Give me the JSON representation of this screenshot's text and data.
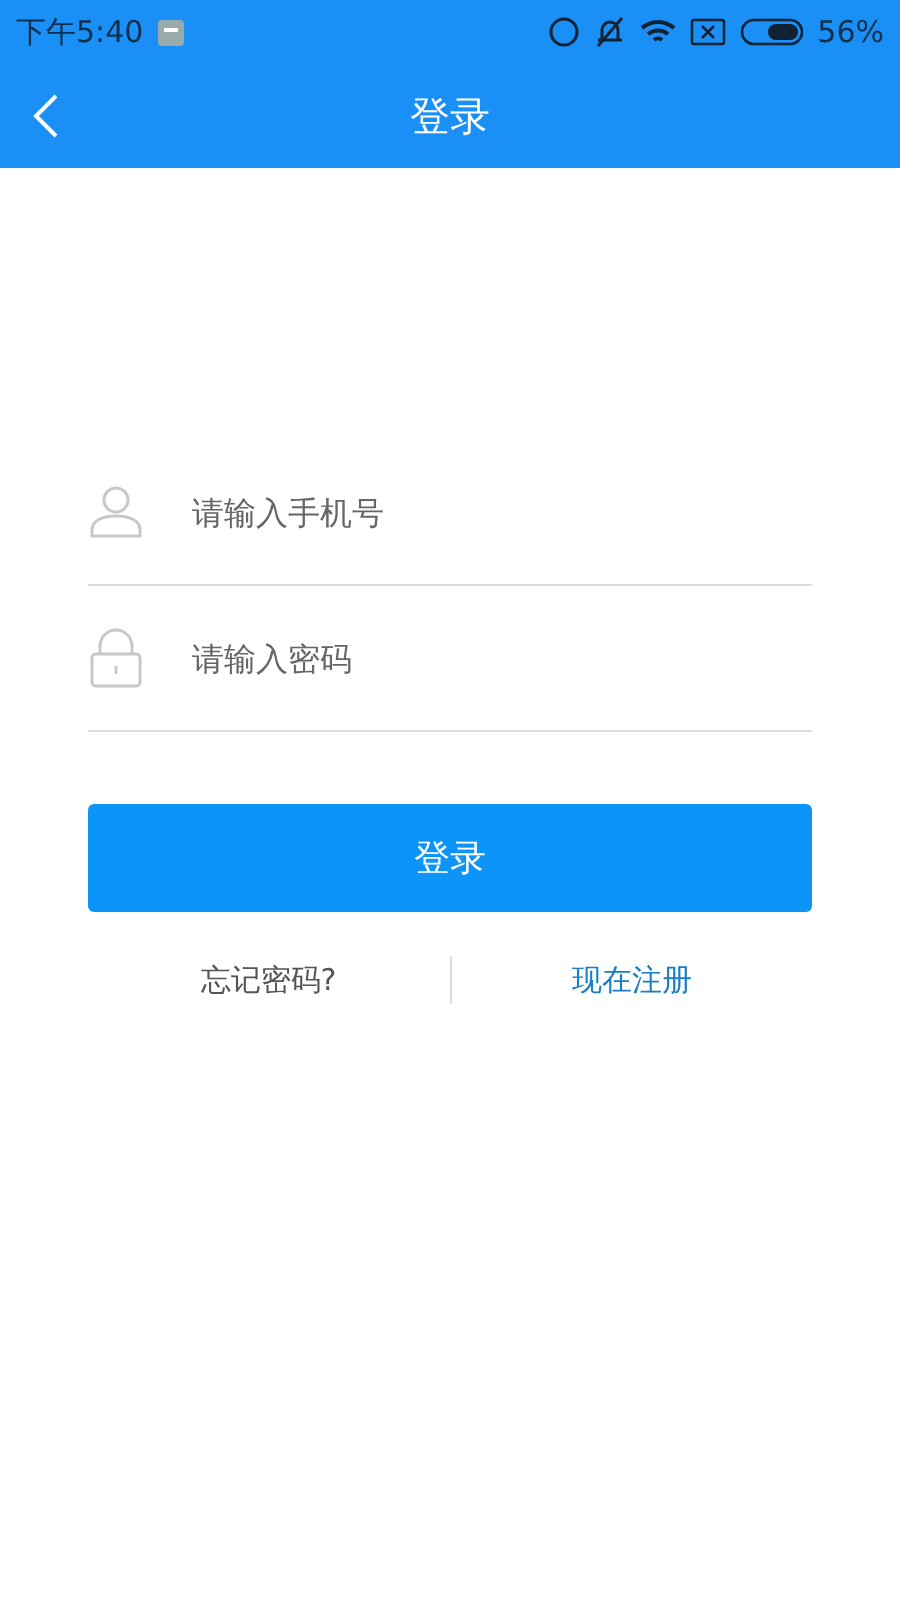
{
  "status_bar": {
    "time": "下午5:40",
    "battery": "56%"
  },
  "header": {
    "title": "登录"
  },
  "fields": [
    {
      "kind": "phone",
      "placeholder": "请输入手机号"
    },
    {
      "kind": "password",
      "placeholder": "请输入密码"
    }
  ],
  "login_button": "登录",
  "links": {
    "forgot": "忘记密码?",
    "register": "现在注册"
  }
}
